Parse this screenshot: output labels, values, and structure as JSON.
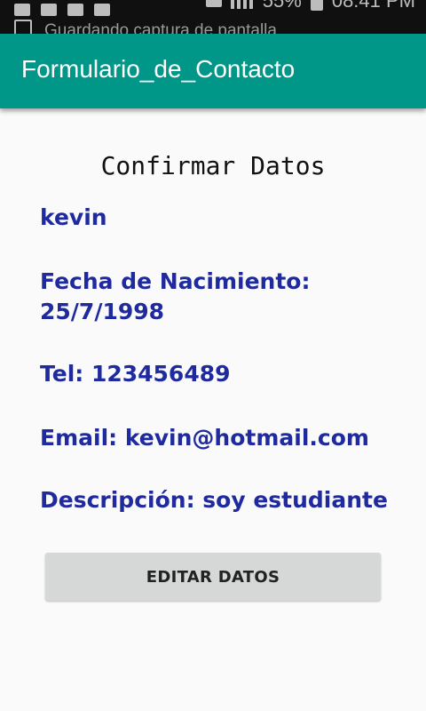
{
  "status_bar": {
    "notification_text": "Guardando captura de pantalla",
    "battery": "55%",
    "time": "08:41 PM"
  },
  "app_bar": {
    "title": "Formulario_de_Contacto"
  },
  "main": {
    "heading": "Confirmar Datos",
    "name": "kevin",
    "birth_label": "Fecha de Nacimiento:",
    "birth_value": "25/7/1998",
    "tel": "Tel: 123456489",
    "email": "Email: kevin@hotmail.com",
    "description": "Descripción: soy estudiante",
    "edit_button": "EDITAR DATOS"
  },
  "colors": {
    "app_bar": "#009688",
    "field_text": "#1f2a9e",
    "button_bg": "#d6d7d7"
  }
}
